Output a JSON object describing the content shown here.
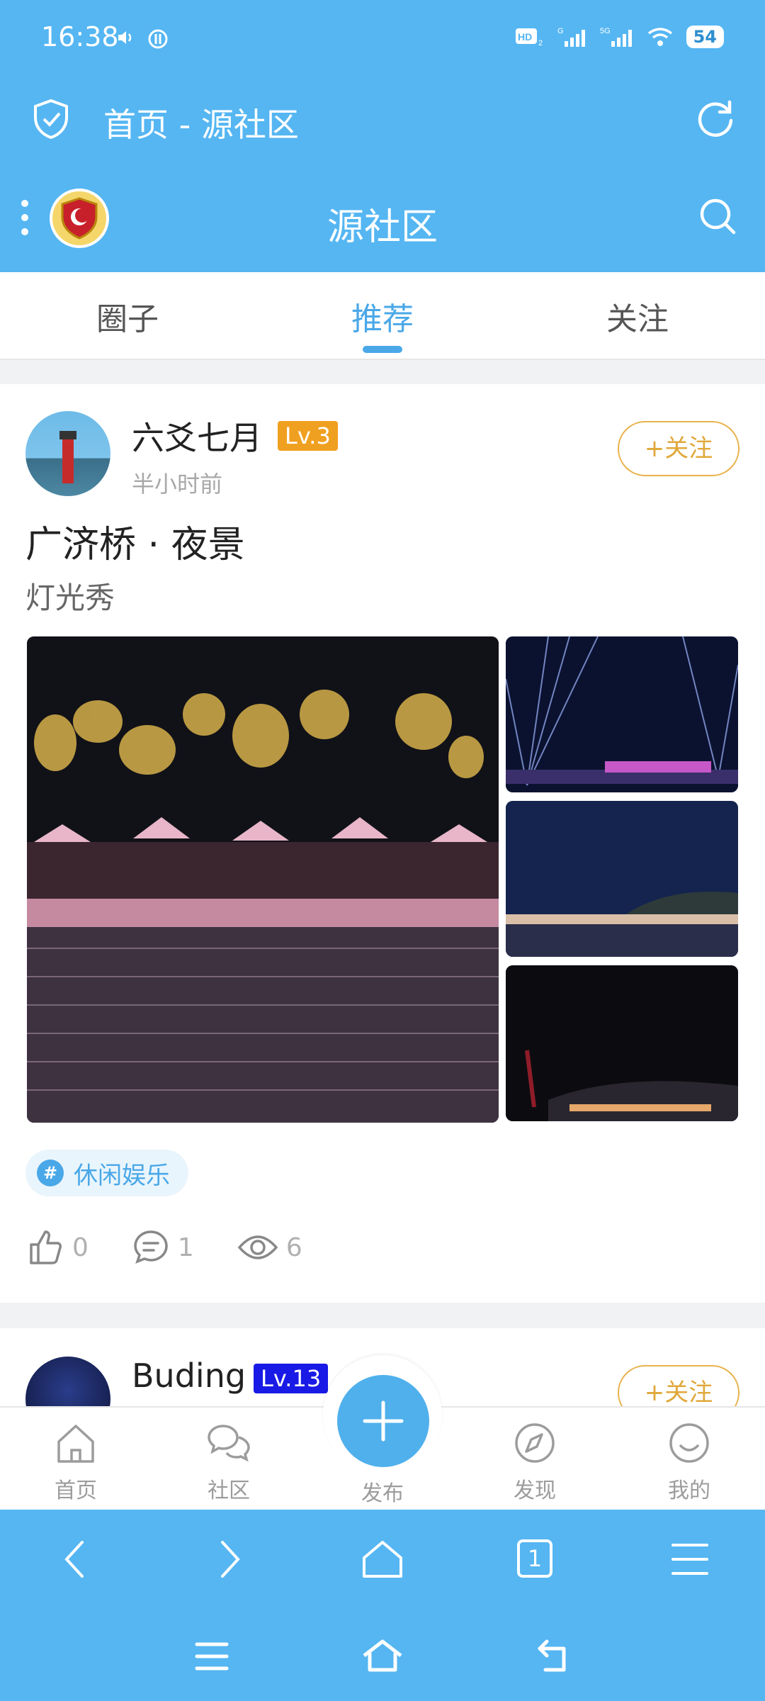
{
  "status_bar": {
    "time": "16:38",
    "battery": "54"
  },
  "title_bar": {
    "title": "首页 - 源社区"
  },
  "app_header": {
    "title": "源社区"
  },
  "tabs": [
    {
      "label": "圈子"
    },
    {
      "label": "推荐",
      "active": true
    },
    {
      "label": "关注"
    }
  ],
  "post1": {
    "username": "六爻七月",
    "level": "Lv.3",
    "time": "半小时前",
    "follow_label": "+关注",
    "title": "广济桥 · 夜景",
    "subtitle": "灯光秀",
    "tag": "休闲娱乐",
    "likes": "0",
    "comments": "1",
    "views": "6"
  },
  "post2": {
    "username": "Buding",
    "level": "Lv.13",
    "follow_label": "+关注"
  },
  "bottom_nav": {
    "home": "首页",
    "community": "社区",
    "publish": "发布",
    "discover": "发现",
    "mine": "我的"
  },
  "browser_bar": {
    "tab_count": "1"
  },
  "colors": {
    "primary": "#55b6f2",
    "accent": "#4aa8e8",
    "level_orange": "#f0a020",
    "level_blue": "#1a1ae6",
    "follow": "#e0a83a"
  }
}
